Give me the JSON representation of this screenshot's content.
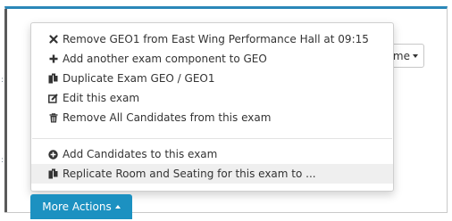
{
  "background_select": {
    "label": "me"
  },
  "menu": {
    "items": [
      {
        "label": "Remove GEO1 from East Wing Performance Hall at 09:15",
        "icon": "times-icon"
      },
      {
        "label": "Add another exam component to GEO",
        "icon": "plus-icon"
      },
      {
        "label": "Duplicate Exam GEO / GEO1",
        "icon": "copy-icon"
      },
      {
        "label": "Edit this exam",
        "icon": "edit-icon"
      },
      {
        "label": "Remove All Candidates from this exam",
        "icon": "trash-icon"
      },
      {
        "label": "Add Candidates to this exam",
        "icon": "plus-circle-icon"
      },
      {
        "label": "Replicate Room and Seating for this exam to ...",
        "icon": "copy-icon"
      }
    ]
  },
  "more_actions": {
    "label": "More Actions"
  },
  "colors": {
    "accent": "#1c91c1",
    "panel_border_top": "#2a87b8",
    "highlight": "#efefef"
  }
}
